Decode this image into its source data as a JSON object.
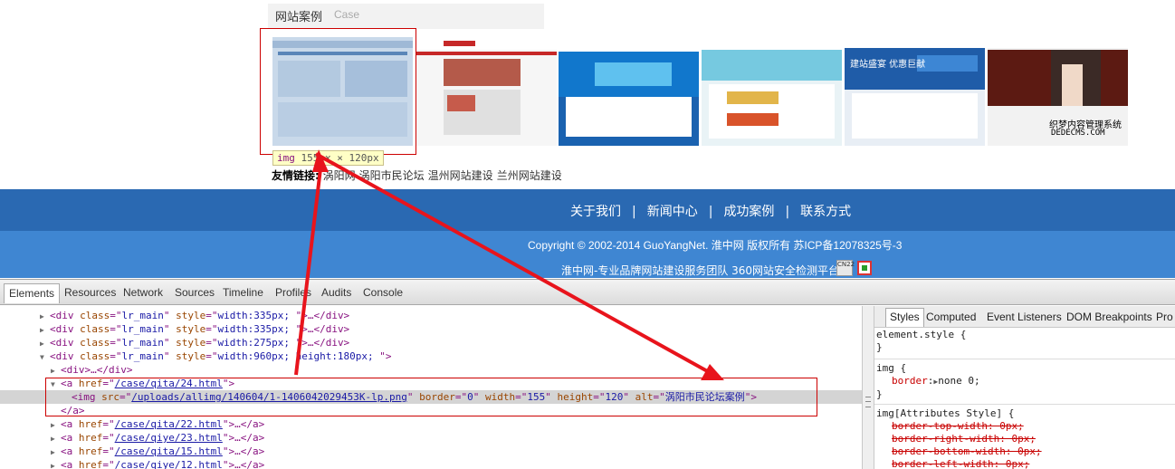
{
  "case_section": {
    "title": "网站案例",
    "subtitle": "Case"
  },
  "tooltip": {
    "tag": "img",
    "dims": "155px × 120px"
  },
  "friend_links": {
    "label": "友情链接:",
    "links": [
      "涡阳网",
      "涡阳市民论坛",
      "温州网站建设",
      "兰州网站建设"
    ]
  },
  "nav": {
    "items": [
      "关于我们",
      "新闻中心",
      "成功案例",
      "联系方式"
    ],
    "separator": "|"
  },
  "footer": {
    "copyright": "Copyright © 2002-2014 GuoYangNet. 淮中网 版权所有 苏ICP备12078325号-3",
    "tagline": "淮中网-专业品牌网站建设服务团队 360网站安全检测平台",
    "badge_text": "CN22"
  },
  "thumb_captions": {
    "t6_line1": "织梦内容管理系统",
    "t6_line2": "DEDECMS.COM",
    "t5_text": "建站盛宴 优惠巨献"
  },
  "devtools": {
    "tabs": [
      "Elements",
      "Resources",
      "Network",
      "Sources",
      "Timeline",
      "Profiles",
      "Audits",
      "Console"
    ],
    "active_tab": "Elements",
    "side_tabs": [
      "Styles",
      "Computed",
      "Event Listeners",
      "DOM Breakpoints",
      "Pro"
    ],
    "active_side_tab": "Styles",
    "dom_lines": {
      "l0": {
        "tag": "div",
        "class": "lr_main",
        "style": "width:335px; ",
        "tail": ">…</div>"
      },
      "l1": {
        "tag": "div",
        "class": "lr_main",
        "style": "width:335px; ",
        "tail": ">…</div>"
      },
      "l2": {
        "tag": "div",
        "class": "lr_main",
        "style": "width:275px; ",
        "tail": ">…</div>"
      },
      "l3": {
        "tag": "div",
        "class": "lr_main",
        "style": "width:960px; height:180px; ",
        "tail": ">"
      },
      "l4": {
        "text": "<div>…</div>"
      },
      "l5": {
        "href": "/case/qita/24.html"
      },
      "l6": {
        "src": "/uploads/allimg/140604/1-1406042029453K-lp.png",
        "border": "0",
        "width": "155",
        "height": "120",
        "alt": "涡阳市民论坛案例"
      },
      "l7": {
        "text": "</a>"
      },
      "l8": {
        "href": "/case/qita/22.html"
      },
      "l9": {
        "href": "/case/qiye/23.html"
      },
      "l10": {
        "href": "/case/qita/15.html"
      },
      "l11": {
        "href": "/case/qiye/12.html"
      }
    },
    "styles": {
      "element_style": "element.style {",
      "img_rule_selector": "img {",
      "img_rule_prop": "border",
      "img_rule_value": "none 0;",
      "attr_rule_selector": "img[Attributes Style] {",
      "attr_props": [
        "border-top-width: 0px;",
        "border-right-width: 0px;",
        "border-bottom-width: 0px;",
        "border-left-width: 0px;"
      ],
      "close": "}"
    }
  },
  "colors": {
    "nav_band": "#2a69b2",
    "footer_band": "#3f86d2",
    "highlight": "#cc0000",
    "tag": "#881280",
    "attr_name": "#994500",
    "attr_value": "#1a1aa6"
  }
}
